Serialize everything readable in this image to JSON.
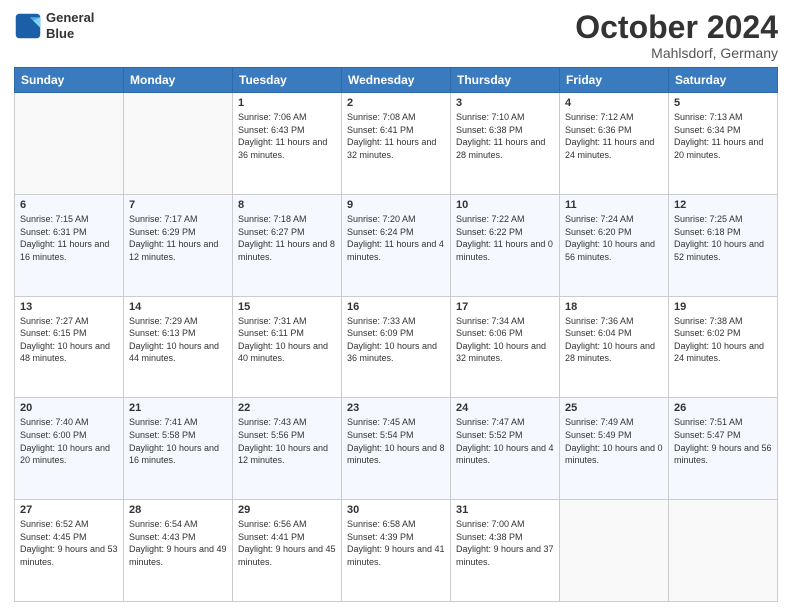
{
  "header": {
    "logo_line1": "General",
    "logo_line2": "Blue",
    "month_title": "October 2024",
    "location": "Mahlsdorf, Germany"
  },
  "weekdays": [
    "Sunday",
    "Monday",
    "Tuesday",
    "Wednesday",
    "Thursday",
    "Friday",
    "Saturday"
  ],
  "weeks": [
    [
      {
        "day": "",
        "empty": true
      },
      {
        "day": "",
        "empty": true
      },
      {
        "day": "1",
        "sunrise": "Sunrise: 7:06 AM",
        "sunset": "Sunset: 6:43 PM",
        "daylight": "Daylight: 11 hours and 36 minutes."
      },
      {
        "day": "2",
        "sunrise": "Sunrise: 7:08 AM",
        "sunset": "Sunset: 6:41 PM",
        "daylight": "Daylight: 11 hours and 32 minutes."
      },
      {
        "day": "3",
        "sunrise": "Sunrise: 7:10 AM",
        "sunset": "Sunset: 6:38 PM",
        "daylight": "Daylight: 11 hours and 28 minutes."
      },
      {
        "day": "4",
        "sunrise": "Sunrise: 7:12 AM",
        "sunset": "Sunset: 6:36 PM",
        "daylight": "Daylight: 11 hours and 24 minutes."
      },
      {
        "day": "5",
        "sunrise": "Sunrise: 7:13 AM",
        "sunset": "Sunset: 6:34 PM",
        "daylight": "Daylight: 11 hours and 20 minutes."
      }
    ],
    [
      {
        "day": "6",
        "sunrise": "Sunrise: 7:15 AM",
        "sunset": "Sunset: 6:31 PM",
        "daylight": "Daylight: 11 hours and 16 minutes."
      },
      {
        "day": "7",
        "sunrise": "Sunrise: 7:17 AM",
        "sunset": "Sunset: 6:29 PM",
        "daylight": "Daylight: 11 hours and 12 minutes."
      },
      {
        "day": "8",
        "sunrise": "Sunrise: 7:18 AM",
        "sunset": "Sunset: 6:27 PM",
        "daylight": "Daylight: 11 hours and 8 minutes."
      },
      {
        "day": "9",
        "sunrise": "Sunrise: 7:20 AM",
        "sunset": "Sunset: 6:24 PM",
        "daylight": "Daylight: 11 hours and 4 minutes."
      },
      {
        "day": "10",
        "sunrise": "Sunrise: 7:22 AM",
        "sunset": "Sunset: 6:22 PM",
        "daylight": "Daylight: 11 hours and 0 minutes."
      },
      {
        "day": "11",
        "sunrise": "Sunrise: 7:24 AM",
        "sunset": "Sunset: 6:20 PM",
        "daylight": "Daylight: 10 hours and 56 minutes."
      },
      {
        "day": "12",
        "sunrise": "Sunrise: 7:25 AM",
        "sunset": "Sunset: 6:18 PM",
        "daylight": "Daylight: 10 hours and 52 minutes."
      }
    ],
    [
      {
        "day": "13",
        "sunrise": "Sunrise: 7:27 AM",
        "sunset": "Sunset: 6:15 PM",
        "daylight": "Daylight: 10 hours and 48 minutes."
      },
      {
        "day": "14",
        "sunrise": "Sunrise: 7:29 AM",
        "sunset": "Sunset: 6:13 PM",
        "daylight": "Daylight: 10 hours and 44 minutes."
      },
      {
        "day": "15",
        "sunrise": "Sunrise: 7:31 AM",
        "sunset": "Sunset: 6:11 PM",
        "daylight": "Daylight: 10 hours and 40 minutes."
      },
      {
        "day": "16",
        "sunrise": "Sunrise: 7:33 AM",
        "sunset": "Sunset: 6:09 PM",
        "daylight": "Daylight: 10 hours and 36 minutes."
      },
      {
        "day": "17",
        "sunrise": "Sunrise: 7:34 AM",
        "sunset": "Sunset: 6:06 PM",
        "daylight": "Daylight: 10 hours and 32 minutes."
      },
      {
        "day": "18",
        "sunrise": "Sunrise: 7:36 AM",
        "sunset": "Sunset: 6:04 PM",
        "daylight": "Daylight: 10 hours and 28 minutes."
      },
      {
        "day": "19",
        "sunrise": "Sunrise: 7:38 AM",
        "sunset": "Sunset: 6:02 PM",
        "daylight": "Daylight: 10 hours and 24 minutes."
      }
    ],
    [
      {
        "day": "20",
        "sunrise": "Sunrise: 7:40 AM",
        "sunset": "Sunset: 6:00 PM",
        "daylight": "Daylight: 10 hours and 20 minutes."
      },
      {
        "day": "21",
        "sunrise": "Sunrise: 7:41 AM",
        "sunset": "Sunset: 5:58 PM",
        "daylight": "Daylight: 10 hours and 16 minutes."
      },
      {
        "day": "22",
        "sunrise": "Sunrise: 7:43 AM",
        "sunset": "Sunset: 5:56 PM",
        "daylight": "Daylight: 10 hours and 12 minutes."
      },
      {
        "day": "23",
        "sunrise": "Sunrise: 7:45 AM",
        "sunset": "Sunset: 5:54 PM",
        "daylight": "Daylight: 10 hours and 8 minutes."
      },
      {
        "day": "24",
        "sunrise": "Sunrise: 7:47 AM",
        "sunset": "Sunset: 5:52 PM",
        "daylight": "Daylight: 10 hours and 4 minutes."
      },
      {
        "day": "25",
        "sunrise": "Sunrise: 7:49 AM",
        "sunset": "Sunset: 5:49 PM",
        "daylight": "Daylight: 10 hours and 0 minutes."
      },
      {
        "day": "26",
        "sunrise": "Sunrise: 7:51 AM",
        "sunset": "Sunset: 5:47 PM",
        "daylight": "Daylight: 9 hours and 56 minutes."
      }
    ],
    [
      {
        "day": "27",
        "sunrise": "Sunrise: 6:52 AM",
        "sunset": "Sunset: 4:45 PM",
        "daylight": "Daylight: 9 hours and 53 minutes."
      },
      {
        "day": "28",
        "sunrise": "Sunrise: 6:54 AM",
        "sunset": "Sunset: 4:43 PM",
        "daylight": "Daylight: 9 hours and 49 minutes."
      },
      {
        "day": "29",
        "sunrise": "Sunrise: 6:56 AM",
        "sunset": "Sunset: 4:41 PM",
        "daylight": "Daylight: 9 hours and 45 minutes."
      },
      {
        "day": "30",
        "sunrise": "Sunrise: 6:58 AM",
        "sunset": "Sunset: 4:39 PM",
        "daylight": "Daylight: 9 hours and 41 minutes."
      },
      {
        "day": "31",
        "sunrise": "Sunrise: 7:00 AM",
        "sunset": "Sunset: 4:38 PM",
        "daylight": "Daylight: 9 hours and 37 minutes."
      },
      {
        "day": "",
        "empty": true
      },
      {
        "day": "",
        "empty": true
      }
    ]
  ]
}
